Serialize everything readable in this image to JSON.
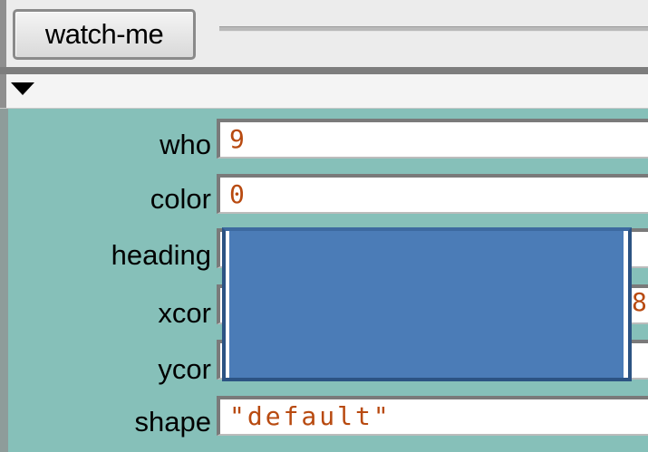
{
  "toolbar": {
    "watch_button_label": "watch-me"
  },
  "collapse": {
    "state": "expanded",
    "icon": "triangle-down-icon"
  },
  "inspector": {
    "fields": [
      {
        "label": "who",
        "value": "9"
      },
      {
        "label": "color",
        "value": "0"
      },
      {
        "label": "heading",
        "value": ""
      },
      {
        "label": "xcor",
        "value": ""
      },
      {
        "label": "ycor",
        "value": ""
      },
      {
        "label": "shape",
        "value": "\"default\""
      }
    ],
    "xcor_peek": "8"
  },
  "colors": {
    "panel_background": "#86c0b9",
    "value_text": "#b84a10",
    "overlay_fill": "#4b7cb7",
    "overlay_border": "#2c5383"
  }
}
